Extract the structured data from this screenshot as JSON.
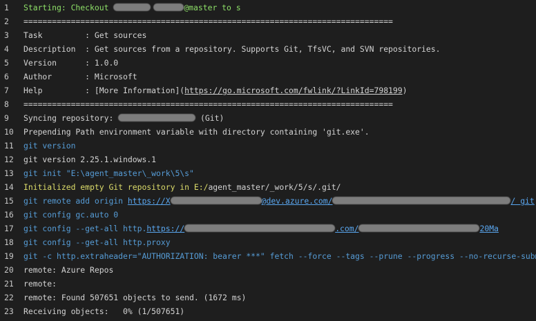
{
  "lines": [
    {
      "n": "1",
      "parts": [
        "Starting: Checkout ",
        "",
        "@master to s"
      ]
    },
    {
      "n": "2",
      "parts": [
        "=============================================================================="
      ]
    },
    {
      "n": "3",
      "parts": [
        "Task         : Get sources"
      ]
    },
    {
      "n": "4",
      "parts": [
        "Description  : Get sources from a repository. Supports Git, TfsVC, and SVN repositories."
      ]
    },
    {
      "n": "5",
      "parts": [
        "Version      : 1.0.0"
      ]
    },
    {
      "n": "6",
      "parts": [
        "Author       : Microsoft"
      ]
    },
    {
      "n": "7",
      "parts": [
        "Help         : [More Information](",
        "https://go.microsoft.com/fwlink/?LinkId=798199",
        ")"
      ]
    },
    {
      "n": "8",
      "parts": [
        "=============================================================================="
      ]
    },
    {
      "n": "9",
      "parts": [
        "Syncing repository: ",
        " (Git)"
      ]
    },
    {
      "n": "10",
      "parts": [
        "Prepending Path environment variable with directory containing 'git.exe'."
      ]
    },
    {
      "n": "11",
      "parts": [
        "git version"
      ]
    },
    {
      "n": "12",
      "parts": [
        "git version 2.25.1.windows.1"
      ]
    },
    {
      "n": "13",
      "parts": [
        "git init \"E:\\agent_master\\_work\\5\\s\""
      ]
    },
    {
      "n": "14",
      "parts": [
        "Initialized empty Git repository in E:/",
        "agent_master/_work/5/s/.git/"
      ]
    },
    {
      "n": "15",
      "parts": [
        "git remote add origin ",
        "https://X",
        "@dev.azure.com/",
        "/ git"
      ]
    },
    {
      "n": "16",
      "parts": [
        "git config gc.auto 0"
      ]
    },
    {
      "n": "17",
      "parts": [
        "git config --get-all http.",
        "https://",
        ".com/",
        "20Ma"
      ]
    },
    {
      "n": "18",
      "parts": [
        "git config --get-all http.proxy"
      ]
    },
    {
      "n": "19",
      "parts": [
        "git -c http.extraheader=\"AUTHORIZATION: bearer ***\" fetch --force --tags --prune --progress --no-recurse-submodul"
      ]
    },
    {
      "n": "20",
      "parts": [
        "remote: Azure Repos"
      ]
    },
    {
      "n": "21",
      "parts": [
        "remote:"
      ]
    },
    {
      "n": "22",
      "parts": [
        "remote: Found 507651 objects to send. (1672 ms)"
      ]
    },
    {
      "n": "23",
      "parts": [
        "Receiving objects:   0% (1/507651)"
      ]
    }
  ]
}
